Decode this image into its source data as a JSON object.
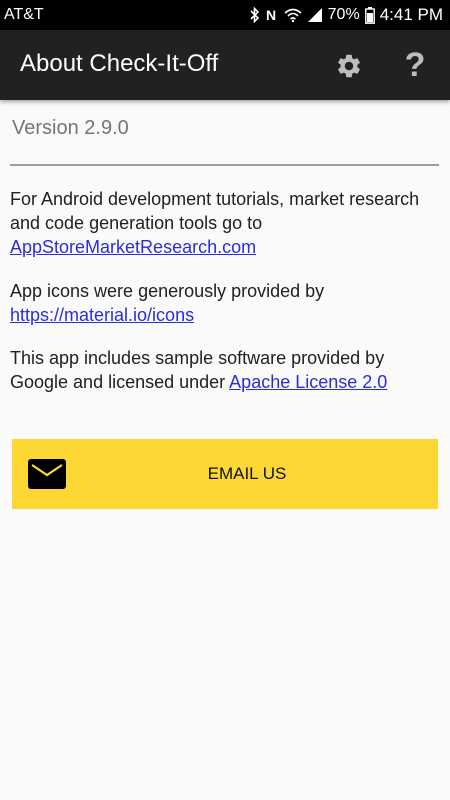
{
  "status_bar": {
    "carrier": "AT&T",
    "battery_percent": "70%",
    "time": "4:41 PM",
    "icons": [
      "bluetooth-icon",
      "nfc-icon",
      "wifi-icon",
      "signal-icon",
      "battery-icon"
    ]
  },
  "app_bar": {
    "title": "About Check-It-Off",
    "settings_icon": "gear-icon",
    "help_glyph": "?"
  },
  "content": {
    "version": "Version 2.9.0",
    "para1_text": "For Android development tutorials, market research and code generation tools go to",
    "para1_link": "AppStoreMarketResearch.com",
    "para2_text": "App icons were generously provided by",
    "para2_link": "https://material.io/icons",
    "para3_text": "This app includes sample software provided by Google and licensed under",
    "para3_link": "Apache License 2.0"
  },
  "email_button": {
    "label": "EMAIL US",
    "icon": "mail-icon",
    "color": "#fdd835"
  },
  "colors": {
    "app_bar": "#212121",
    "link": "#2a2ed6",
    "background": "#fafafa"
  }
}
